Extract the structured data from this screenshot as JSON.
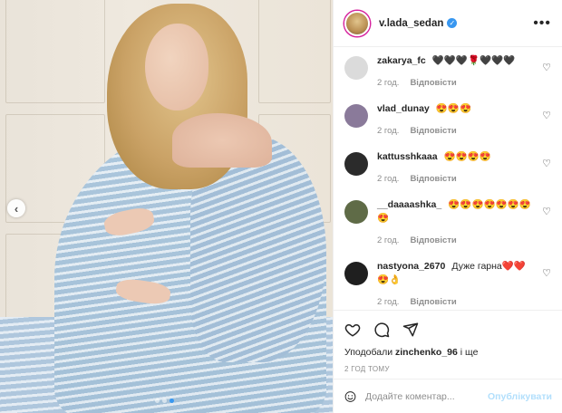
{
  "post": {
    "username": "v.lada_sedan",
    "verified": true,
    "more_icon": "more-horizontal-icon",
    "carousel": {
      "slide_count": 3,
      "active_slide": 3
    }
  },
  "comments": [
    {
      "user": "zakarya_fc",
      "text": "🖤🖤🖤🌹🖤🖤🖤",
      "time": "2 год.",
      "reply": "Відповісти",
      "avatar_color": "#dbdbdb"
    },
    {
      "user": "vlad_dunay",
      "text": "😍😍😍",
      "time": "2 год.",
      "reply": "Відповісти",
      "avatar_color": "#8a7a9a"
    },
    {
      "user": "kattusshkaaa",
      "text": "😍😍😍😍",
      "time": "2 год.",
      "reply": "Відповісти",
      "avatar_color": "#2b2b2b"
    },
    {
      "user": "__daaaashka_",
      "text": "😍😍😍😍😍😍😍😍",
      "time": "2 год.",
      "reply": "Відповісти",
      "avatar_color": "#5f6b47"
    },
    {
      "user": "nastyona_2670",
      "text": "Дуже гарна❤️❤️😍👌",
      "time": "2 год.",
      "reply": "Відповісти",
      "avatar_color": "#1f1f1f"
    }
  ],
  "actions": {
    "like_icon": "heart-icon",
    "comment_icon": "comment-icon",
    "share_icon": "share-icon"
  },
  "likes": {
    "prefix": "Уподобали",
    "user": "zinchenko_96",
    "suffix": "і ще"
  },
  "timestamp": "2 год тому",
  "add_comment": {
    "placeholder": "Додайте коментар...",
    "emoji_icon": "emoji-icon",
    "publish_label": "Опублікувати"
  },
  "colors": {
    "accent": "#3897f0",
    "publish_disabled": "#b2dffc",
    "meta_gray": "#8e8e8e"
  }
}
